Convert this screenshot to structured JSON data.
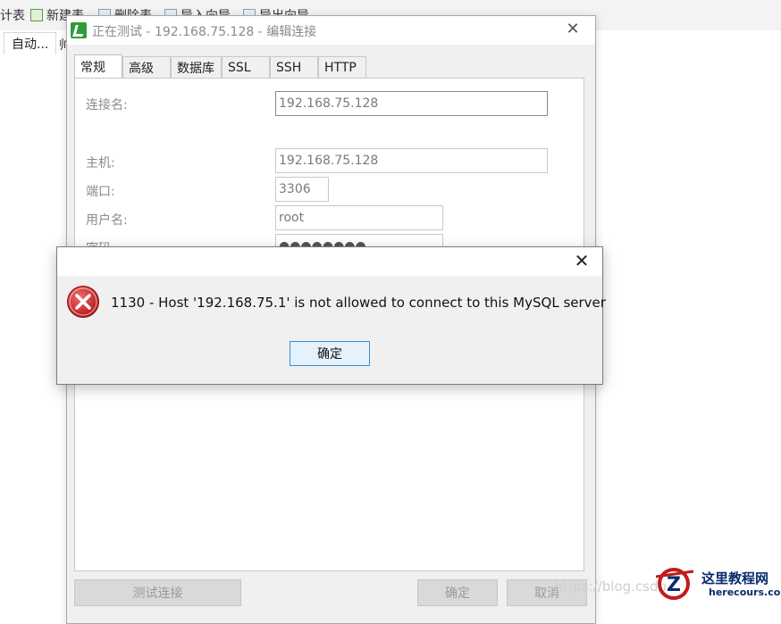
{
  "app_toolbar": {
    "items": [
      {
        "label": "计表",
        "icon": "table-icon"
      },
      {
        "label": "新建表",
        "icon": "new-table-icon"
      },
      {
        "label": "删除表",
        "icon": "delete-table-icon"
      },
      {
        "label": "导入向导",
        "icon": "import-icon"
      },
      {
        "label": "导出向导",
        "icon": "export-icon"
      }
    ]
  },
  "app_tabs": {
    "current": "自动...",
    "next_partial": "帅"
  },
  "connection_dialog": {
    "title": "正在测试 - 192.168.75.128 - 编辑连接",
    "tabs": [
      "常规",
      "高级",
      "数据库",
      "SSL",
      "SSH",
      "HTTP"
    ],
    "active_tab": "常规",
    "fields": {
      "connection_name": {
        "label": "连接名:",
        "value": "192.168.75.128"
      },
      "host": {
        "label": "主机:",
        "value": "192.168.75.128"
      },
      "port": {
        "label": "端口:",
        "value": "3306"
      },
      "username": {
        "label": "用户名:",
        "value": "root"
      },
      "password": {
        "label": "密码:",
        "value": "●●●●●●●●"
      }
    },
    "buttons": {
      "test": "测试连接",
      "ok": "确定",
      "cancel": "取消"
    }
  },
  "error_dialog": {
    "message": "1130 - Host '192.168.75.1' is not allowed to connect to this MySQL server",
    "ok_label": "确定",
    "icon": "error-icon"
  },
  "watermark": {
    "url_text": "https://blog.csdn",
    "site_cn": "这里教程网",
    "site_en": "herecours.com"
  },
  "colors": {
    "error_red": "#d22b2b",
    "focus_blue": "#3a8fd6",
    "logo_green": "#2f9b3a"
  }
}
